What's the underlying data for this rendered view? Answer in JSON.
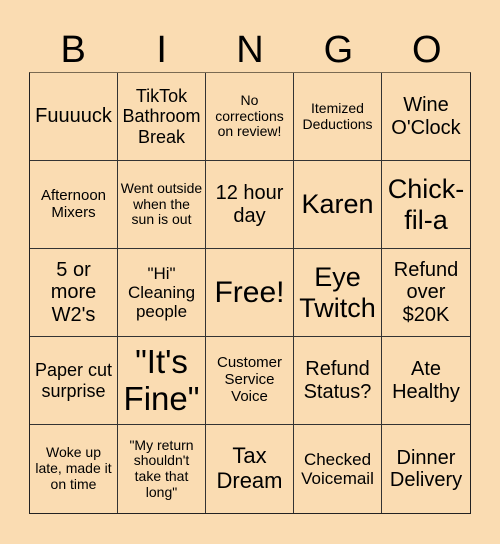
{
  "header": [
    "B",
    "I",
    "N",
    "G",
    "O"
  ],
  "cells": [
    "Fuuuuck",
    "TikTok Bathroom Break",
    "No corrections on review!",
    "Itemized Deductions",
    "Wine O'Clock",
    "Afternoon Mixers",
    "Went outside when the sun is out",
    "12 hour day",
    "Karen",
    "Chick-fil-a",
    "5 or more W2's",
    "\"Hi\" Cleaning people",
    "Free!",
    "Eye Twitch",
    "Refund over $20K",
    "Paper cut surprise",
    "\"It's Fine\"",
    "Customer Service Voice",
    "Refund Status?",
    "Ate Healthy",
    "Woke up late, made it on time",
    "\"My return shouldn't take that long\"",
    "Tax Dream",
    "Checked Voicemail",
    "Dinner Delivery"
  ],
  "colors": {
    "background": "#FADCB2",
    "grid_line": "#333333"
  }
}
